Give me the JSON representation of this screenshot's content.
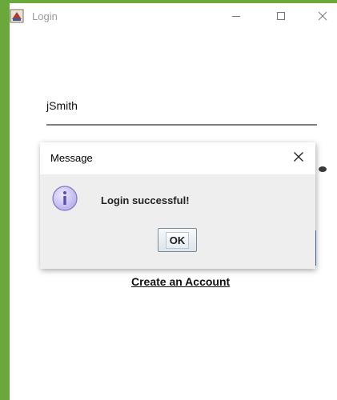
{
  "window": {
    "title": "Login",
    "controls": {
      "minimize_icon": "minimize-icon",
      "maximize_icon": "maximize-icon",
      "close_icon": "close-icon"
    }
  },
  "form": {
    "username_value": "jSmith",
    "create_account_label": "Create an Account"
  },
  "dialog": {
    "title": "Message",
    "message": "Login successful!",
    "ok_label": "OK",
    "icon": "info-icon",
    "close_icon": "close-icon"
  },
  "colors": {
    "desktop_background": "#6aa83b",
    "window_background": "#ffffff",
    "dialog_background": "#eeeeee",
    "info_icon_fill": "#c9c3ef"
  }
}
